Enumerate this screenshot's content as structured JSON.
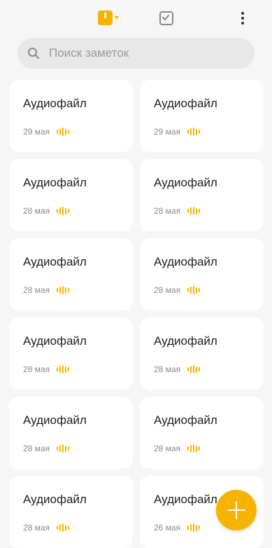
{
  "header": {
    "tabs": [
      {
        "icon": "notes-folder-icon",
        "active": true
      },
      {
        "icon": "tasks-checkbox-icon",
        "active": false
      }
    ],
    "menu_icon": "more-vertical-icon"
  },
  "search": {
    "placeholder": "Поиск заметок",
    "icon": "search-icon"
  },
  "notes": [
    {
      "title": "Аудиофайл",
      "date": "29 мая"
    },
    {
      "title": "Аудиофайл",
      "date": "29 мая"
    },
    {
      "title": "Аудиофайл",
      "date": "28 мая"
    },
    {
      "title": "Аудиофайл",
      "date": "28 мая"
    },
    {
      "title": "Аудиофайл",
      "date": "28 мая"
    },
    {
      "title": "Аудиофайл",
      "date": "28 мая"
    },
    {
      "title": "Аудиофайл",
      "date": "28 мая"
    },
    {
      "title": "Аудиофайл",
      "date": "28 мая"
    },
    {
      "title": "Аудиофайл",
      "date": "28 мая"
    },
    {
      "title": "Аудиофайл",
      "date": "28 мая"
    },
    {
      "title": "Аудиофайл",
      "date": "28 мая"
    },
    {
      "title": "Аудиофайл",
      "date": "26 мая"
    }
  ],
  "fab": {
    "icon": "plus-icon"
  },
  "colors": {
    "accent": "#f6b400",
    "background": "#f6f6f6",
    "card": "#ffffff"
  }
}
